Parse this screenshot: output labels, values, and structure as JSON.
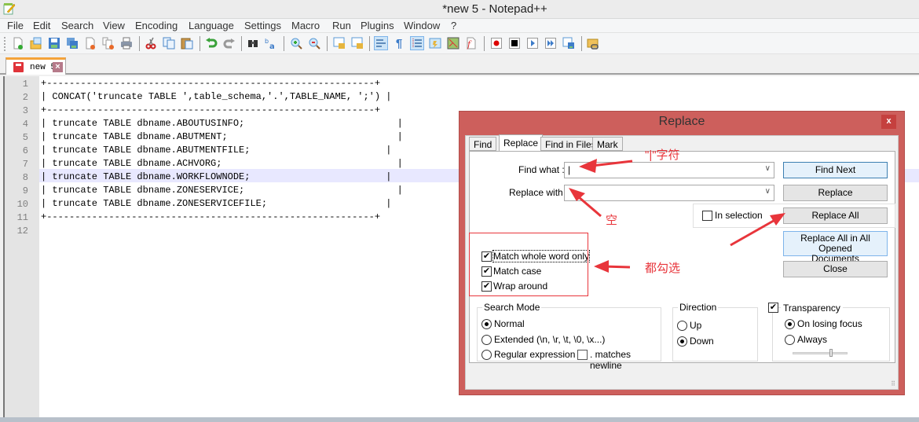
{
  "window": {
    "title": "*new  5 - Notepad++"
  },
  "menu": [
    "File",
    "Edit",
    "Search",
    "View",
    "Encoding",
    "Language",
    "Settings",
    "Macro",
    "Run",
    "Plugins",
    "Window",
    "?"
  ],
  "toolbar": {
    "icons": [
      "new-file-icon",
      "open-file-icon",
      "save-icon",
      "save-all-icon",
      "close-icon",
      "close-all-icon",
      "print-icon",
      "cut-icon",
      "copy-icon",
      "paste-icon",
      "undo-icon",
      "redo-icon",
      "find-icon",
      "replace-icon",
      "zoom-in-icon",
      "zoom-out-icon",
      "sync-vertical-icon",
      "sync-horizontal-icon",
      "word-wrap-icon",
      "show-all-chars-icon",
      "indent-guide-icon",
      "udl-icon",
      "doc-map-icon",
      "function-list-icon",
      "macro-record-icon",
      "macro-stop-icon",
      "macro-play-icon",
      "macro-run-multiple-icon",
      "macro-save-icon",
      "folder-workspace-icon"
    ]
  },
  "tabs": [
    {
      "label": "new  5",
      "modified": true
    }
  ],
  "editor": {
    "current_line": 8,
    "lines": [
      "+----------------------------------------------------------+",
      "| CONCAT('truncate TABLE ',table_schema,'.',TABLE_NAME, ';') |",
      "+----------------------------------------------------------+",
      "| truncate TABLE dbname.ABOUTUSINFO;                           |",
      "| truncate TABLE dbname.ABUTMENT;                              |",
      "| truncate TABLE dbname.ABUTMENTFILE;                        |",
      "| truncate TABLE dbname.ACHVORG;                               |",
      "| truncate TABLE dbname.WORKFLOWNODE;                        |",
      "| truncate TABLE dbname.ZONESERVICE;                           |",
      "| truncate TABLE dbname.ZONESERVICEFILE;                     |",
      "+----------------------------------------------------------+",
      ""
    ]
  },
  "dialog": {
    "title": "Replace",
    "close": "x",
    "tabs": [
      "Find",
      "Replace",
      "Find in Files",
      "Mark"
    ],
    "active_tab": "Replace",
    "find_what_label": "Find what :",
    "find_what_value": "|",
    "replace_with_label": "Replace with :",
    "replace_with_value": "",
    "buttons": {
      "find_next": "Find Next",
      "replace": "Replace",
      "replace_all": "Replace All",
      "replace_all_open_1": "Replace All in All Opened",
      "replace_all_open_2": "Documents",
      "close": "Close"
    },
    "in_selection": {
      "label": "In selection",
      "checked": false
    },
    "options": [
      {
        "label": "Match whole word only",
        "checked": true
      },
      {
        "label": "Match case",
        "checked": true
      },
      {
        "label": "Wrap around",
        "checked": true
      }
    ],
    "search_mode": {
      "title": "Search Mode",
      "options": [
        "Normal",
        "Extended (\\n, \\r, \\t, \\0, \\x...)",
        "Regular expression"
      ],
      "selected": "Normal",
      "dot_newline": {
        "label": ". matches newline",
        "checked": false
      }
    },
    "direction": {
      "title": "Direction",
      "options": [
        "Up",
        "Down"
      ],
      "selected": "Down"
    },
    "transparency": {
      "label": "Transparency",
      "checked": true,
      "options": [
        "On losing focus",
        "Always"
      ],
      "selected": "On losing focus",
      "level": 0.7
    }
  },
  "annotations": {
    "find_note": "\"|\"字符",
    "replace_note": "空",
    "options_note": "都勾选"
  },
  "colors": {
    "dialog_frame": "#cd5f5c",
    "annotation": "#e8353b",
    "current_line": "#e8e8ff"
  }
}
